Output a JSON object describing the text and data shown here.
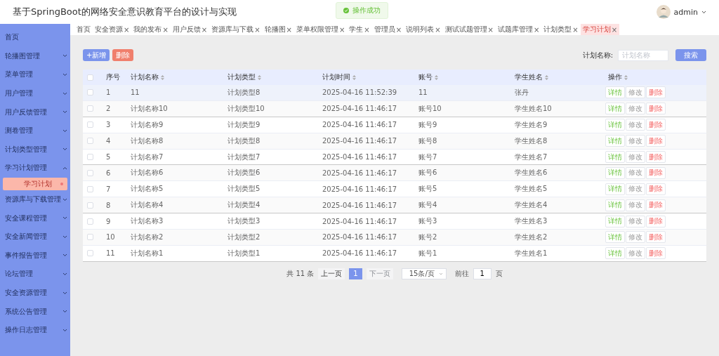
{
  "header": {
    "title": "基于SpringBoot的网络安全意识教育平台的设计与实现",
    "toast": "操作成功",
    "user": "admin"
  },
  "sidebar": {
    "items": [
      {
        "label": "首页",
        "kind": "link"
      },
      {
        "label": "轮播图管理",
        "kind": "group",
        "expanded": false
      },
      {
        "label": "菜单管理",
        "kind": "group",
        "expanded": false
      },
      {
        "label": "用户管理",
        "kind": "group",
        "expanded": false
      },
      {
        "label": "用户反馈管理",
        "kind": "group",
        "expanded": false
      },
      {
        "label": "测卷管理",
        "kind": "group",
        "expanded": false
      },
      {
        "label": "计划类型管理",
        "kind": "group",
        "expanded": false
      },
      {
        "label": "学习计划管理",
        "kind": "group",
        "expanded": true,
        "children": [
          {
            "label": "学习计划",
            "selected": true
          }
        ]
      },
      {
        "label": "资源库与下载管理",
        "kind": "group",
        "expanded": false
      },
      {
        "label": "安全课程管理",
        "kind": "group",
        "expanded": false
      },
      {
        "label": "安全新闻管理",
        "kind": "group",
        "expanded": false
      },
      {
        "label": "事件报告管理",
        "kind": "group",
        "expanded": false
      },
      {
        "label": "论坛管理",
        "kind": "group",
        "expanded": false
      },
      {
        "label": "安全资源管理",
        "kind": "group",
        "expanded": false
      },
      {
        "label": "系统公告管理",
        "kind": "group",
        "expanded": false
      },
      {
        "label": "操作日志管理",
        "kind": "group",
        "expanded": false
      }
    ]
  },
  "tabs": [
    {
      "label": "首页",
      "selected": false
    },
    {
      "label": "安全资源",
      "close": "×",
      "selected": false
    },
    {
      "label": "我的发布",
      "close": "×",
      "selected": false
    },
    {
      "label": "用户反馈",
      "close": "×",
      "selected": false
    },
    {
      "label": "资源库与下载",
      "close": "×",
      "selected": false
    },
    {
      "label": "轮播图",
      "close": "×",
      "selected": false
    },
    {
      "label": "菜单权限管理",
      "close": "×",
      "selected": false
    },
    {
      "label": "学生",
      "close": "×",
      "selected": false
    },
    {
      "label": "管理员",
      "close": "×",
      "selected": false
    },
    {
      "label": "说明列表",
      "close": "×",
      "selected": false
    },
    {
      "label": "测试试题管理",
      "close": "×",
      "selected": false
    },
    {
      "label": "试题库管理",
      "close": "×",
      "selected": false
    },
    {
      "label": "计划类型",
      "close": "×",
      "selected": false
    },
    {
      "label": "学习计划",
      "close": "×",
      "selected": true
    }
  ],
  "toolbar": {
    "add": "+新增",
    "delete": "删除",
    "search_label": "计划名称:",
    "search": {
      "placeholder": "计划名称"
    },
    "search_button": "搜索"
  },
  "table": {
    "header_checked": false,
    "columns": [
      {
        "label": "序号",
        "sortable": false
      },
      {
        "label": "计划名称",
        "sortable": true
      },
      {
        "label": "计划类型",
        "sortable": true
      },
      {
        "label": "计划时间",
        "sortable": true
      },
      {
        "label": "账号",
        "sortable": true
      },
      {
        "label": "学生姓名",
        "sortable": true
      },
      {
        "label": "操作",
        "sortable": true
      }
    ],
    "rows": [
      {
        "checked": false,
        "highlighted": true,
        "cells": [
          "1",
          "11",
          "计划类型8",
          "2025-04-16 11:52:39",
          "11",
          "张丹"
        ],
        "actions": [
          {
            "label": "详情",
            "kind": "view"
          },
          {
            "label": "修改",
            "kind": "edit"
          },
          {
            "label": "删除",
            "kind": "delete"
          }
        ]
      },
      {
        "checked": false,
        "highlighted": false,
        "cells": [
          "2",
          "计划名称10",
          "计划类型10",
          "2025-04-16 11:46:17",
          "账号10",
          "学生姓名10"
        ],
        "actions": [
          {
            "label": "详情",
            "kind": "view"
          },
          {
            "label": "修改",
            "kind": "edit"
          },
          {
            "label": "删除",
            "kind": "delete"
          }
        ]
      },
      {
        "checked": false,
        "highlighted": false,
        "cells": [
          "3",
          "计划名称9",
          "计划类型9",
          "2025-04-16 11:46:17",
          "账号9",
          "学生姓名9"
        ],
        "actions": [
          {
            "label": "详情",
            "kind": "view"
          },
          {
            "label": "修改",
            "kind": "edit"
          },
          {
            "label": "删除",
            "kind": "delete"
          }
        ]
      },
      {
        "checked": false,
        "highlighted": false,
        "cells": [
          "4",
          "计划名称8",
          "计划类型8",
          "2025-04-16 11:46:17",
          "账号8",
          "学生姓名8"
        ],
        "actions": [
          {
            "label": "详情",
            "kind": "view"
          },
          {
            "label": "修改",
            "kind": "edit"
          },
          {
            "label": "删除",
            "kind": "delete"
          }
        ]
      },
      {
        "checked": false,
        "highlighted": false,
        "cells": [
          "5",
          "计划名称7",
          "计划类型7",
          "2025-04-16 11:46:17",
          "账号7",
          "学生姓名7"
        ],
        "actions": [
          {
            "label": "详情",
            "kind": "view"
          },
          {
            "label": "修改",
            "kind": "edit"
          },
          {
            "label": "删除",
            "kind": "delete"
          }
        ]
      },
      {
        "checked": false,
        "highlighted": false,
        "cells": [
          "6",
          "计划名称6",
          "计划类型6",
          "2025-04-16 11:46:17",
          "账号6",
          "学生姓名6"
        ],
        "actions": [
          {
            "label": "详情",
            "kind": "view"
          },
          {
            "label": "修改",
            "kind": "edit"
          },
          {
            "label": "删除",
            "kind": "delete"
          }
        ]
      },
      {
        "checked": false,
        "highlighted": false,
        "cells": [
          "7",
          "计划名称5",
          "计划类型5",
          "2025-04-16 11:46:17",
          "账号5",
          "学生姓名5"
        ],
        "actions": [
          {
            "label": "详情",
            "kind": "view"
          },
          {
            "label": "修改",
            "kind": "edit"
          },
          {
            "label": "删除",
            "kind": "delete"
          }
        ]
      },
      {
        "checked": false,
        "highlighted": false,
        "cells": [
          "8",
          "计划名称4",
          "计划类型4",
          "2025-04-16 11:46:17",
          "账号4",
          "学生姓名4"
        ],
        "actions": [
          {
            "label": "详情",
            "kind": "view"
          },
          {
            "label": "修改",
            "kind": "edit"
          },
          {
            "label": "删除",
            "kind": "delete"
          }
        ]
      },
      {
        "checked": false,
        "highlighted": false,
        "cells": [
          "9",
          "计划名称3",
          "计划类型3",
          "2025-04-16 11:46:17",
          "账号3",
          "学生姓名3"
        ],
        "actions": [
          {
            "label": "详情",
            "kind": "view"
          },
          {
            "label": "修改",
            "kind": "edit"
          },
          {
            "label": "删除",
            "kind": "delete"
          }
        ]
      },
      {
        "checked": false,
        "highlighted": false,
        "cells": [
          "10",
          "计划名称2",
          "计划类型2",
          "2025-04-16 11:46:17",
          "账号2",
          "学生姓名2"
        ],
        "actions": [
          {
            "label": "详情",
            "kind": "view"
          },
          {
            "label": "修改",
            "kind": "edit"
          },
          {
            "label": "删除",
            "kind": "delete"
          }
        ]
      },
      {
        "checked": false,
        "highlighted": false,
        "cells": [
          "11",
          "计划名称1",
          "计划类型1",
          "2025-04-16 11:46:17",
          "账号1",
          "学生姓名1"
        ],
        "actions": [
          {
            "label": "详情",
            "kind": "view"
          },
          {
            "label": "修改",
            "kind": "edit"
          },
          {
            "label": "删除",
            "kind": "delete"
          }
        ]
      }
    ]
  },
  "pagination": {
    "total": "共 11 条",
    "prev": {
      "label": "上一页",
      "disabled": false
    },
    "pages": [
      {
        "label": "1",
        "selected": true
      }
    ],
    "next": {
      "label": "下一页",
      "disabled": true
    },
    "page_size": "15条/页",
    "goto": "前往",
    "goto_value": "1",
    "page_unit": "页"
  }
}
